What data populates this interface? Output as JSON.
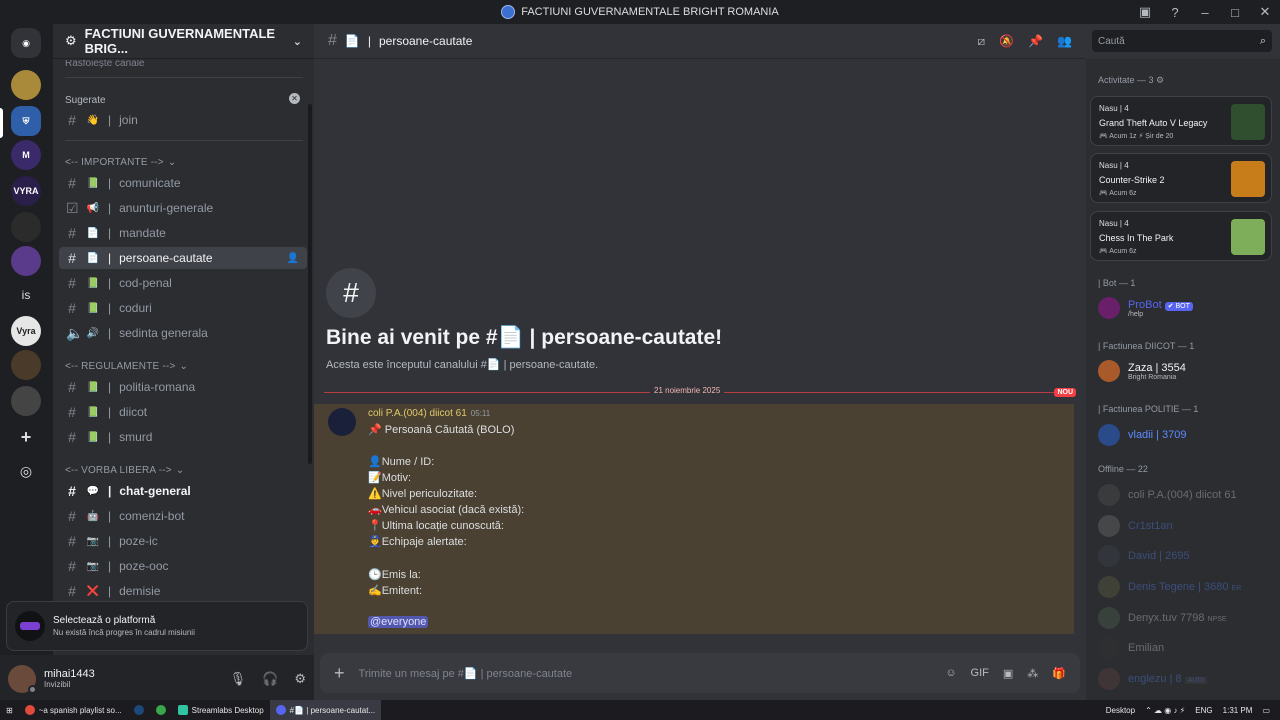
{
  "window": {
    "title": "FACTIUNI GUVERNAMENTALE BRIGHT ROMANIA"
  },
  "server": {
    "name": "FACTIUNI GUVERNAMENTALE BRIG..."
  },
  "channels": {
    "partial_top": "Răsfoiește canale",
    "suggested_label": "Sugerate",
    "suggested": [
      {
        "emoji": "👋",
        "name": "join"
      }
    ],
    "categories": [
      {
        "name": "<-- IMPORTANTE -->",
        "items": [
          {
            "emoji": "📗",
            "name": "comunicate"
          },
          {
            "emoji": "📢",
            "name": "anunturi-generale"
          },
          {
            "emoji": "📄",
            "name": "mandate"
          },
          {
            "emoji": "📄",
            "name": "persoane-cautate"
          },
          {
            "emoji": "📗",
            "name": "cod-penal"
          },
          {
            "emoji": "📗",
            "name": "coduri"
          },
          {
            "emoji": "🔊",
            "name": "sedinta generala"
          }
        ]
      },
      {
        "name": "<-- REGULAMENTE -->",
        "items": [
          {
            "emoji": "📗",
            "name": "politia-romana"
          },
          {
            "emoji": "📗",
            "name": "diicot"
          },
          {
            "emoji": "📗",
            "name": "smurd"
          }
        ]
      },
      {
        "name": "<-- VORBA LIBERA -->",
        "items": [
          {
            "emoji": "💬",
            "name": "chat-general"
          },
          {
            "emoji": "🤖",
            "name": "comenzi-bot"
          },
          {
            "emoji": "📷",
            "name": "poze-ic"
          },
          {
            "emoji": "📷",
            "name": "poze-ooc"
          },
          {
            "emoji": "❌",
            "name": "demisie"
          }
        ]
      }
    ]
  },
  "quest": {
    "title": "Selectează o platformă",
    "subtitle": "Nu există încă progres în cadrul misiunii"
  },
  "user": {
    "name": "mihai1443",
    "status": "Invizibil"
  },
  "header": {
    "channel": "persoane-cautate",
    "search_placeholder": "Caută"
  },
  "welcome": {
    "title_prefix": "Bine ai venit pe #",
    "title_channel": "persoane-cautate!",
    "subtitle_prefix": "Acesta este începutul canalului #",
    "subtitle_channel": "persoane-cautate."
  },
  "date_divider": "21 noiembrie 2025",
  "new_badge": "NOU",
  "message": {
    "author": "coli P.A.(004) diicot 61",
    "time": "05:11",
    "lines": [
      "📌 Persoană Căutată (BOLO)",
      "",
      "👤Nume / ID:",
      "📝Motiv:",
      "⚠️Nivel periculozitate:",
      "🚗Vehicul asociat (dacă există):",
      "📍Ultima locație cunoscută:",
      "👮Echipaje alertate:",
      "",
      "🕒Emis la:",
      "✍️Emitent:",
      ""
    ],
    "mention": "@everyone"
  },
  "composer": {
    "placeholder": "Trimite un mesaj pe #📄 | persoane-cautate"
  },
  "members": {
    "activity_header": "Activitate — 3",
    "activities": [
      {
        "user": "Nasu | 4",
        "game": "Grand Theft Auto V Legacy",
        "meta": "🎮 Acum 1z  ⚡ Șir de 20",
        "color": "#2f4f2f"
      },
      {
        "user": "Nasu | 4",
        "game": "Counter-Strike 2",
        "meta": "🎮 Acum 6z",
        "color": "#c77d1a"
      },
      {
        "user": "Nasu | 4",
        "game": "Chess In The Park",
        "meta": "🎮 Acum 6z",
        "color": "#7fae5a"
      }
    ],
    "groups": [
      {
        "header": "| Bot — 1",
        "items": [
          {
            "name": "ProBot",
            "sub": "/help",
            "tag": "✔ BOT",
            "color": "#5865f2"
          }
        ]
      },
      {
        "header": "| Factiunea DIICOT — 1",
        "items": [
          {
            "name": "Zaza | 3554",
            "sub": "Bright Romania",
            "tag": "",
            "color": "#f2f3f5"
          }
        ]
      },
      {
        "header": "| Factiunea POLITIE — 1",
        "items": [
          {
            "name": "vladii | 3709",
            "sub": "",
            "tag": "",
            "color": "#5b8cff"
          }
        ]
      }
    ],
    "offline_header": "Offline — 22",
    "offline": [
      "coli P.A.(004) diicot 61",
      "Cr1st1an",
      "David | 2695",
      "Denis Tegene | 3680",
      "Denyx.tuv 7798",
      "Emilian",
      "englezu | 8"
    ],
    "offline_tags": [
      "",
      "",
      "",
      "ER",
      "NPSE",
      "",
      "AUDI"
    ]
  },
  "taskbar": {
    "items": [
      "~a spanish playlist so...",
      "",
      "",
      "Streamlabs Desktop",
      "#📄 | persoane-cautat..."
    ],
    "desktop_label": "Desktop",
    "lang": "ENG",
    "time": "1:31 PM"
  }
}
